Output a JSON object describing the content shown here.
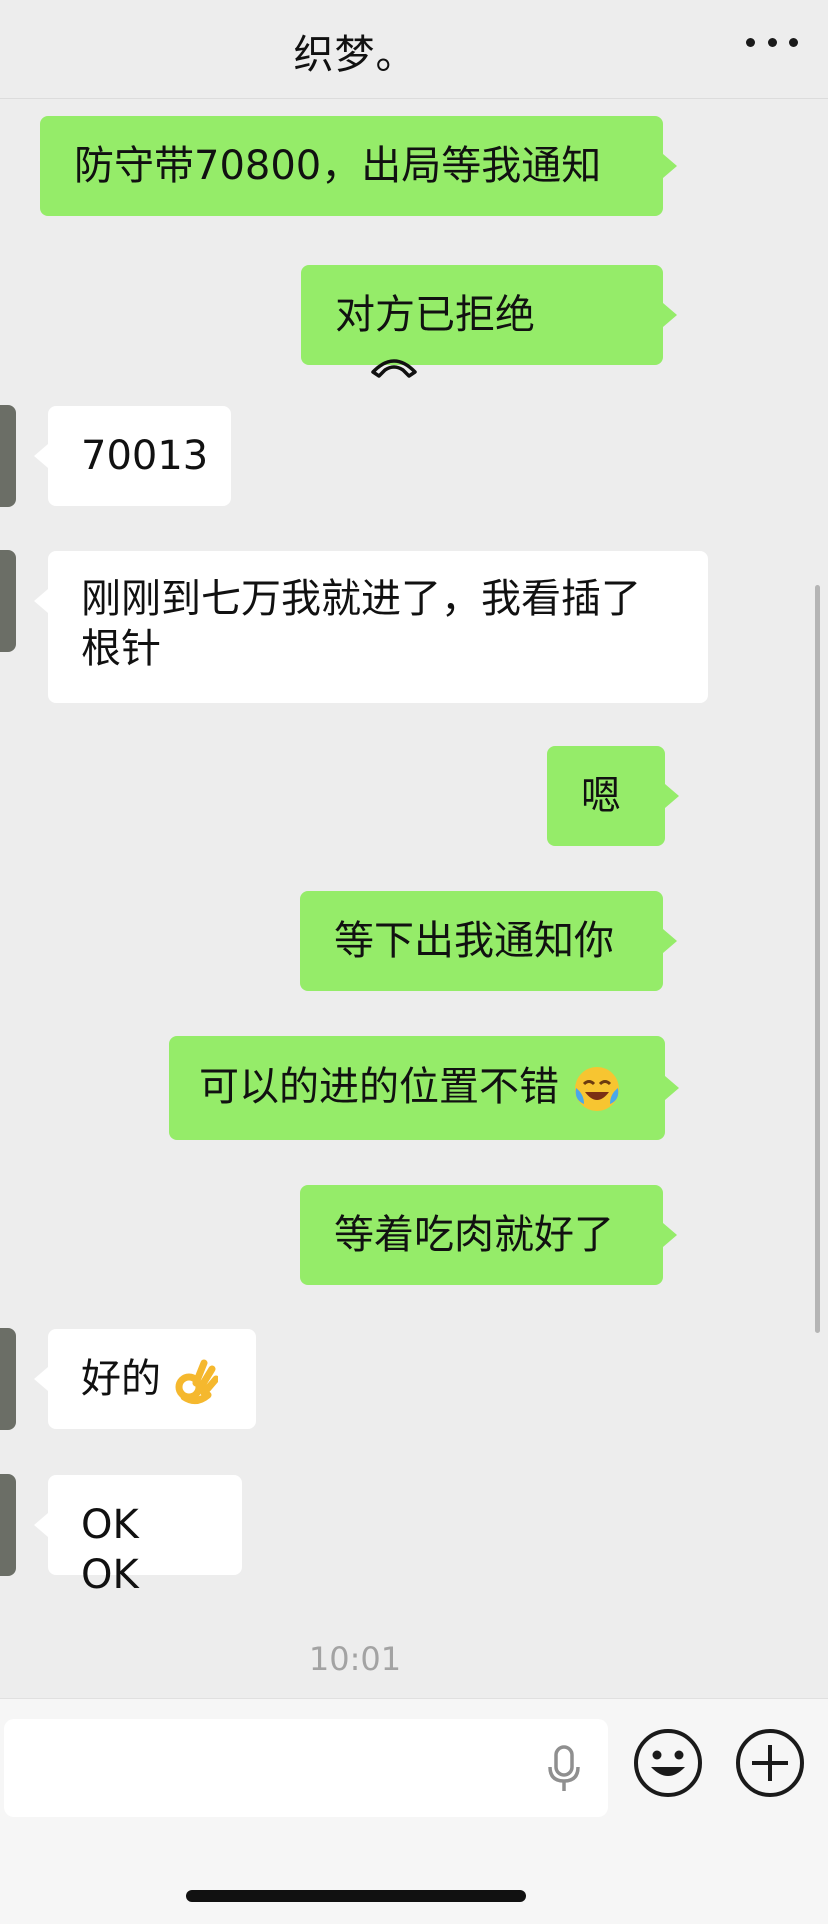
{
  "header": {
    "title": "织梦。",
    "more_icon": "more-dots-icon"
  },
  "messages": [
    {
      "side": "right",
      "text": "防守带70800，出局等我通知"
    },
    {
      "side": "right",
      "text": "对方已拒绝",
      "icon": "phone-hangup-icon"
    },
    {
      "side": "left",
      "text": "70013"
    },
    {
      "side": "left",
      "line1": "刚刚到七万我就进了，我看插了",
      "line2": "根针"
    },
    {
      "side": "right",
      "text": "嗯"
    },
    {
      "side": "right",
      "text": "等下出我通知你"
    },
    {
      "side": "right",
      "text": "可以的进的位置不错",
      "emoji": "laughing-tears-emoji"
    },
    {
      "side": "right",
      "text": "等着吃肉就好了"
    },
    {
      "side": "left",
      "text": "好的",
      "emoji": "ok-hand-emoji"
    },
    {
      "side": "left",
      "text": "OK OK"
    }
  ],
  "timestamp": "10:01",
  "input_bar": {
    "voice_icon": "microphone-icon",
    "emoji_icon": "smiley-icon",
    "plus_icon": "plus-circle-icon"
  },
  "colors": {
    "bubble_me": "#95ec69",
    "bubble_other": "#ffffff",
    "background": "#ededed"
  }
}
